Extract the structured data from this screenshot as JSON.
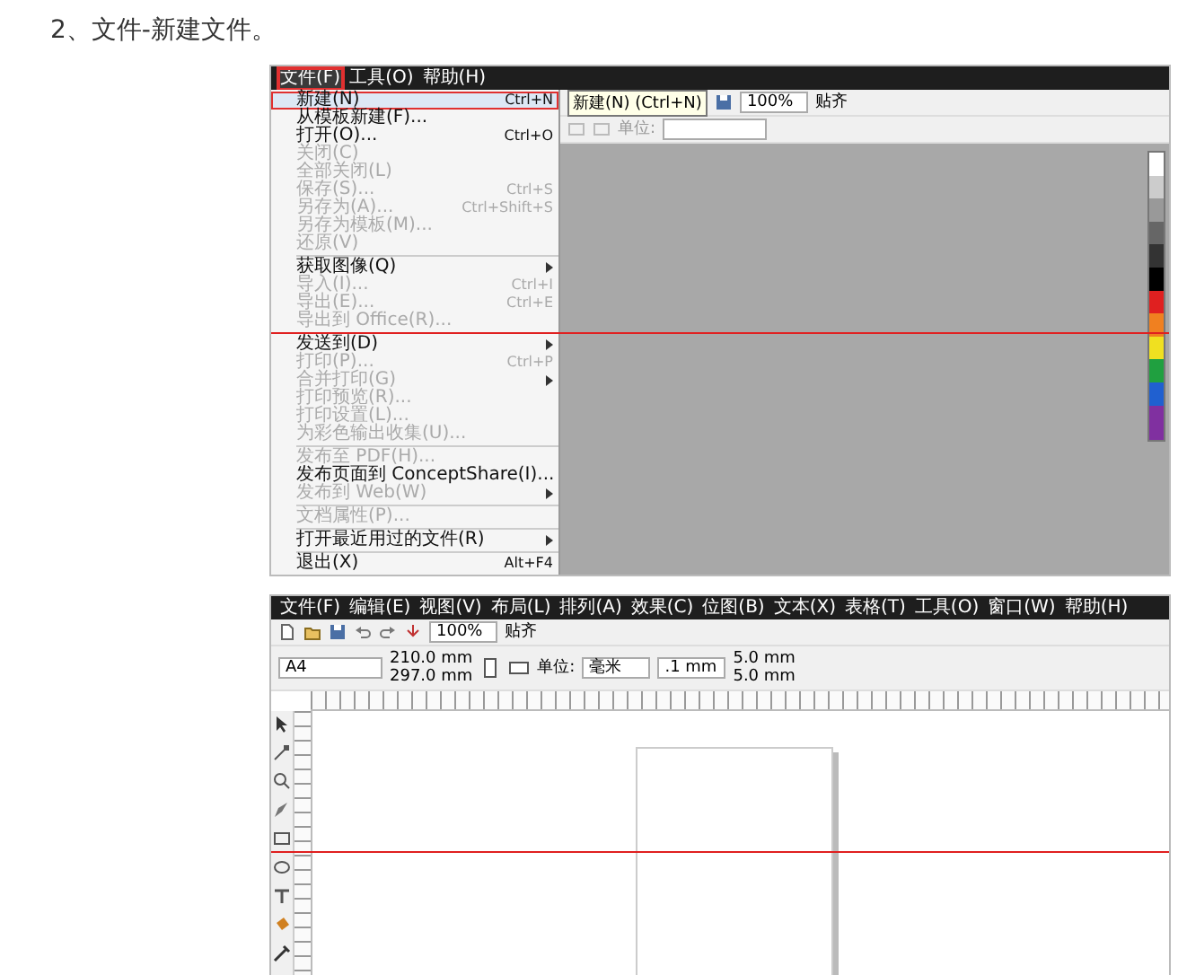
{
  "heading": "2、文件-新建文件。",
  "screenshot_1": {
    "menubar": [
      {
        "label": "文件(F)",
        "selected": true
      },
      {
        "label": "工具(O)",
        "selected": false
      },
      {
        "label": "帮助(H)",
        "selected": false
      }
    ],
    "file_menu": [
      {
        "kind": "item",
        "label": "新建(N)",
        "shortcut": "Ctrl+N",
        "selected": true,
        "disabled": false,
        "submenu": false
      },
      {
        "kind": "item",
        "label": "从模板新建(F)...",
        "selected": false,
        "disabled": false,
        "submenu": false
      },
      {
        "kind": "item",
        "label": "打开(O)...",
        "shortcut": "Ctrl+O",
        "selected": false,
        "disabled": false,
        "submenu": false
      },
      {
        "kind": "item",
        "label": "关闭(C)",
        "selected": false,
        "disabled": true,
        "submenu": false
      },
      {
        "kind": "item",
        "label": "全部关闭(L)",
        "selected": false,
        "disabled": true,
        "submenu": false
      },
      {
        "kind": "item",
        "label": "保存(S)...",
        "shortcut": "Ctrl+S",
        "selected": false,
        "disabled": true,
        "submenu": false
      },
      {
        "kind": "item",
        "label": "另存为(A)...",
        "shortcut": "Ctrl+Shift+S",
        "selected": false,
        "disabled": true,
        "submenu": false
      },
      {
        "kind": "item",
        "label": "另存为模板(M)...",
        "selected": false,
        "disabled": true,
        "submenu": false
      },
      {
        "kind": "item",
        "label": "还原(V)",
        "selected": false,
        "disabled": true,
        "submenu": false
      },
      {
        "kind": "separator"
      },
      {
        "kind": "item",
        "label": "获取图像(Q)",
        "selected": false,
        "disabled": false,
        "submenu": true
      },
      {
        "kind": "item",
        "label": "导入(I)...",
        "shortcut": "Ctrl+I",
        "selected": false,
        "disabled": true,
        "submenu": false
      },
      {
        "kind": "item",
        "label": "导出(E)...",
        "shortcut": "Ctrl+E",
        "selected": false,
        "disabled": true,
        "submenu": false
      },
      {
        "kind": "item",
        "label": "导出到 Office(R)...",
        "selected": false,
        "disabled": true,
        "submenu": false
      },
      {
        "kind": "separator"
      },
      {
        "kind": "item",
        "label": "发送到(D)",
        "selected": false,
        "disabled": false,
        "submenu": true
      },
      {
        "kind": "item",
        "label": "打印(P)...",
        "shortcut": "Ctrl+P",
        "selected": false,
        "disabled": true,
        "submenu": false
      },
      {
        "kind": "item",
        "label": "合并打印(G)",
        "selected": false,
        "disabled": true,
        "submenu": true
      },
      {
        "kind": "item",
        "label": "打印预览(R)...",
        "selected": false,
        "disabled": true,
        "submenu": false
      },
      {
        "kind": "item",
        "label": "打印设置(L)...",
        "selected": false,
        "disabled": true,
        "submenu": false
      },
      {
        "kind": "item",
        "label": "为彩色输出收集(U)...",
        "selected": false,
        "disabled": true,
        "submenu": false
      },
      {
        "kind": "separator"
      },
      {
        "kind": "item",
        "label": "发布至 PDF(H)...",
        "selected": false,
        "disabled": true,
        "submenu": false
      },
      {
        "kind": "item",
        "label": "发布页面到 ConceptShare(I)...",
        "selected": false,
        "disabled": false,
        "submenu": false
      },
      {
        "kind": "item",
        "label": "发布到 Web(W)",
        "selected": false,
        "disabled": true,
        "submenu": true
      },
      {
        "kind": "separator"
      },
      {
        "kind": "item",
        "label": "文档属性(P)...",
        "selected": false,
        "disabled": true,
        "submenu": false
      },
      {
        "kind": "separator"
      },
      {
        "kind": "item",
        "label": "打开最近用过的文件(R)",
        "selected": false,
        "disabled": false,
        "submenu": true
      },
      {
        "kind": "separator"
      },
      {
        "kind": "item",
        "label": "退出(X)",
        "shortcut": "Alt+F4",
        "selected": false,
        "disabled": false,
        "submenu": false
      }
    ],
    "tooltip": "新建(N) (Ctrl+N)",
    "zoom": "100%",
    "snap": "贴齐",
    "unit_label": "单位:"
  },
  "screenshot_2": {
    "menubar": [
      "文件(F)",
      "编辑(E)",
      "视图(V)",
      "布局(L)",
      "排列(A)",
      "效果(C)",
      "位图(B)",
      "文本(X)",
      "表格(T)",
      "工具(O)",
      "窗口(W)",
      "帮助(H)"
    ],
    "zoom": "100%",
    "snap": "贴齐",
    "page_size": "A4",
    "page_width": "210.0 mm",
    "page_height": "297.0 mm",
    "unit_label": "单位:",
    "unit": "毫米",
    "nudge": ".1 mm",
    "duplicate_x": "5.0 mm",
    "duplicate_y": "5.0 mm"
  }
}
